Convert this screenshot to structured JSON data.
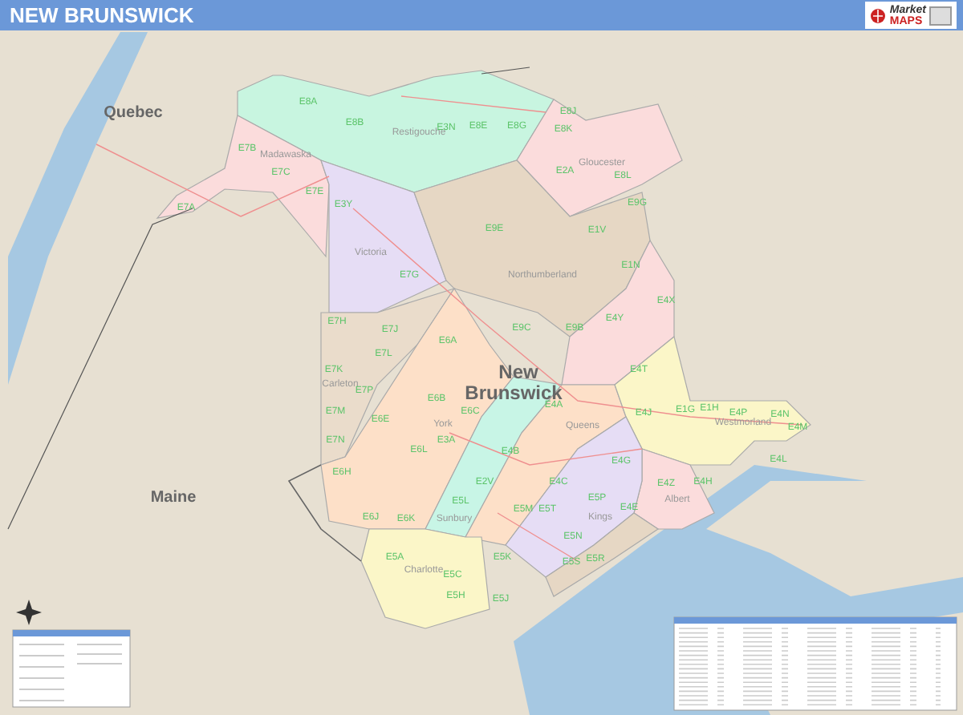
{
  "title": "NEW BRUNSWICK",
  "logo": {
    "brand_1": "Market",
    "brand_2": "MAPS"
  },
  "labels": [
    {
      "text": "Quebec",
      "kind": "region"
    },
    {
      "text": "Maine",
      "kind": "region"
    },
    {
      "text": "New",
      "kind": "province"
    },
    {
      "text": "Brunswick",
      "kind": "province"
    },
    {
      "text": "Restigouche",
      "kind": "county"
    },
    {
      "text": "Madawaska",
      "kind": "county"
    },
    {
      "text": "Gloucester",
      "kind": "county"
    },
    {
      "text": "Victoria",
      "kind": "county"
    },
    {
      "text": "Northumberland",
      "kind": "county"
    },
    {
      "text": "Carleton",
      "kind": "county"
    },
    {
      "text": "York",
      "kind": "county"
    },
    {
      "text": "Queens",
      "kind": "county"
    },
    {
      "text": "Westmorland",
      "kind": "county"
    },
    {
      "text": "Albert",
      "kind": "county"
    },
    {
      "text": "Sunbury",
      "kind": "county"
    },
    {
      "text": "Kings",
      "kind": "county"
    },
    {
      "text": "Charlotte",
      "kind": "county"
    },
    {
      "text": "E8A",
      "kind": "code"
    },
    {
      "text": "E8B",
      "kind": "code"
    },
    {
      "text": "E3N",
      "kind": "code"
    },
    {
      "text": "E8E",
      "kind": "code"
    },
    {
      "text": "E8G",
      "kind": "code"
    },
    {
      "text": "E8J",
      "kind": "code"
    },
    {
      "text": "E8K",
      "kind": "code"
    },
    {
      "text": "E7B",
      "kind": "code"
    },
    {
      "text": "E7C",
      "kind": "code"
    },
    {
      "text": "E7E",
      "kind": "code"
    },
    {
      "text": "E7A",
      "kind": "code"
    },
    {
      "text": "E3Y",
      "kind": "code"
    },
    {
      "text": "E2A",
      "kind": "code"
    },
    {
      "text": "E8L",
      "kind": "code"
    },
    {
      "text": "E9G",
      "kind": "code"
    },
    {
      "text": "E9E",
      "kind": "code"
    },
    {
      "text": "E1V",
      "kind": "code"
    },
    {
      "text": "E7G",
      "kind": "code"
    },
    {
      "text": "E1N",
      "kind": "code"
    },
    {
      "text": "E7H",
      "kind": "code"
    },
    {
      "text": "E7J",
      "kind": "code"
    },
    {
      "text": "E6A",
      "kind": "code"
    },
    {
      "text": "E9C",
      "kind": "code"
    },
    {
      "text": "E9B",
      "kind": "code"
    },
    {
      "text": "E4Y",
      "kind": "code"
    },
    {
      "text": "E4X",
      "kind": "code"
    },
    {
      "text": "E7L",
      "kind": "code"
    },
    {
      "text": "E7K",
      "kind": "code"
    },
    {
      "text": "E4T",
      "kind": "code"
    },
    {
      "text": "E7P",
      "kind": "code"
    },
    {
      "text": "E6B",
      "kind": "code"
    },
    {
      "text": "E6C",
      "kind": "code"
    },
    {
      "text": "E4A",
      "kind": "code"
    },
    {
      "text": "E4J",
      "kind": "code"
    },
    {
      "text": "E1G",
      "kind": "code"
    },
    {
      "text": "E1H",
      "kind": "code"
    },
    {
      "text": "E4P",
      "kind": "code"
    },
    {
      "text": "E4N",
      "kind": "code"
    },
    {
      "text": "E7M",
      "kind": "code"
    },
    {
      "text": "E6E",
      "kind": "code"
    },
    {
      "text": "E3A",
      "kind": "code"
    },
    {
      "text": "E4M",
      "kind": "code"
    },
    {
      "text": "E7N",
      "kind": "code"
    },
    {
      "text": "E6L",
      "kind": "code"
    },
    {
      "text": "E4B",
      "kind": "code"
    },
    {
      "text": "E4L",
      "kind": "code"
    },
    {
      "text": "E4G",
      "kind": "code"
    },
    {
      "text": "E6H",
      "kind": "code"
    },
    {
      "text": "E2V",
      "kind": "code"
    },
    {
      "text": "E4C",
      "kind": "code"
    },
    {
      "text": "E4Z",
      "kind": "code"
    },
    {
      "text": "E4H",
      "kind": "code"
    },
    {
      "text": "E6J",
      "kind": "code"
    },
    {
      "text": "E6K",
      "kind": "code"
    },
    {
      "text": "E5L",
      "kind": "code"
    },
    {
      "text": "E5M",
      "kind": "code"
    },
    {
      "text": "E5T",
      "kind": "code"
    },
    {
      "text": "E5P",
      "kind": "code"
    },
    {
      "text": "E4E",
      "kind": "code"
    },
    {
      "text": "E5N",
      "kind": "code"
    },
    {
      "text": "E5A",
      "kind": "code"
    },
    {
      "text": "E5C",
      "kind": "code"
    },
    {
      "text": "E5K",
      "kind": "code"
    },
    {
      "text": "E5S",
      "kind": "code"
    },
    {
      "text": "E5R",
      "kind": "code"
    },
    {
      "text": "E5H",
      "kind": "code"
    },
    {
      "text": "E5J",
      "kind": "code"
    }
  ]
}
